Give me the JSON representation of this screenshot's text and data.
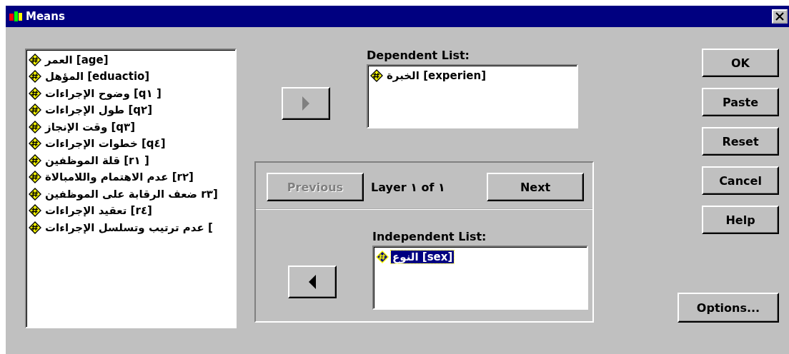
{
  "window": {
    "title": "Means"
  },
  "variables": [
    {
      "label": "العمر [age]",
      "selected": false
    },
    {
      "label": "المؤهل [eduactio]",
      "selected": false
    },
    {
      "label": "وضوح الإجراءات [q١ ]",
      "selected": false
    },
    {
      "label": "طول الإجراءات [q٢]",
      "selected": false
    },
    {
      "label": "وقت الإنجاز [q٣]",
      "selected": false
    },
    {
      "label": "خطوات الإجراءات [q٤]",
      "selected": false
    },
    {
      "label": "قلة الموظفين [r١ ]",
      "selected": false
    },
    {
      "label": "عدم الاهتمام واللامبالاة [r٢]",
      "selected": false
    },
    {
      "label": "ضعف الرقابة على الموظفين r٣]",
      "selected": false
    },
    {
      "label": "تعقيد الإجراءات [r٤]",
      "selected": false
    },
    {
      "label": "عدم ترتيب وتسلسل الإجراءات [",
      "selected": false
    }
  ],
  "dependent": {
    "label": "Dependent List:",
    "move_disabled": true,
    "items": [
      {
        "label": "الخبرة [experien]",
        "selected": false
      }
    ]
  },
  "layer": {
    "previous": {
      "label": "Previous",
      "disabled": true
    },
    "text": "Layer ١ of ١",
    "next": {
      "label": "Next",
      "disabled": false
    }
  },
  "independent": {
    "label": "Independent List:",
    "move_disabled": false,
    "items": [
      {
        "label": "النوع [sex]",
        "selected": true
      }
    ]
  },
  "buttons": [
    {
      "label": "OK"
    },
    {
      "label": "Paste"
    },
    {
      "label": "Reset"
    },
    {
      "label": "Cancel"
    },
    {
      "label": "Help"
    }
  ],
  "options_button": {
    "label": "Options..."
  }
}
